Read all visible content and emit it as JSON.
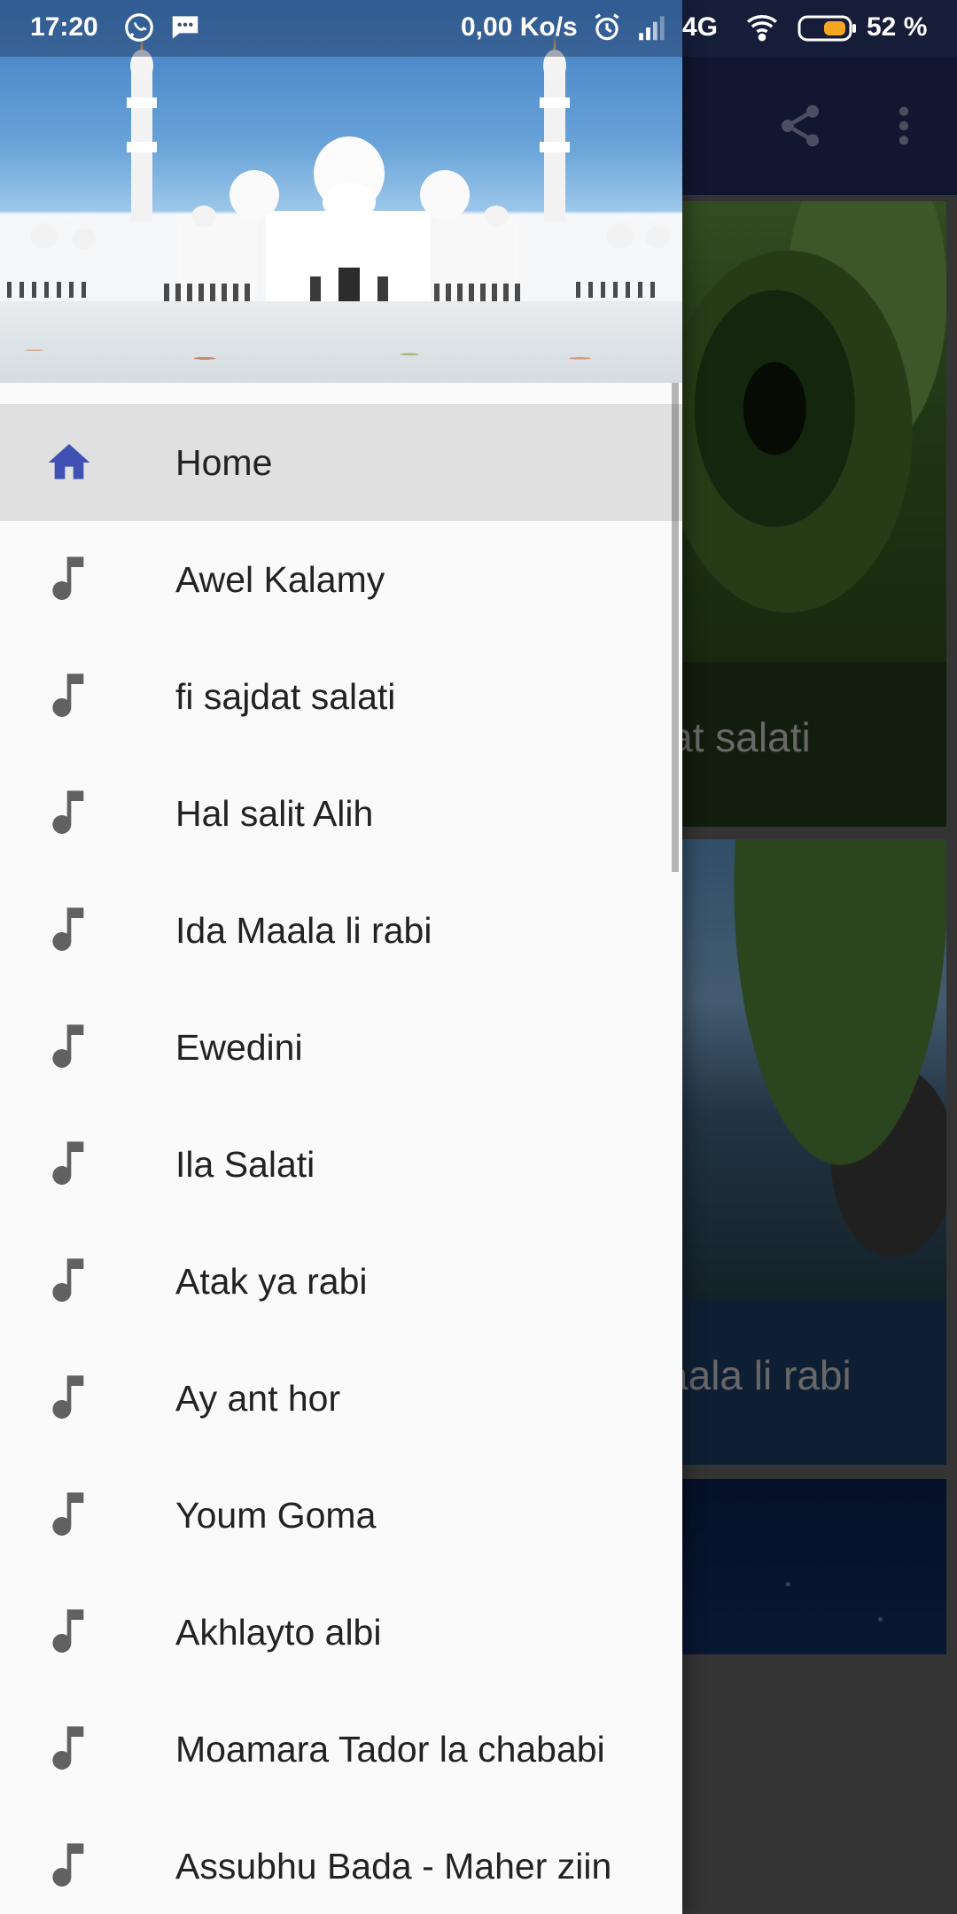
{
  "status_bar": {
    "time": "17:20",
    "network_speed": "0,00 Ko/s",
    "network_type": "4G",
    "battery_percent": "52 %",
    "icons": [
      "whatsapp-icon",
      "message-icon",
      "alarm-icon",
      "signal-icon",
      "wifi-icon",
      "battery-icon"
    ]
  },
  "background_app": {
    "toolbar": {
      "icons": [
        "share-icon",
        "overflow-menu-icon"
      ]
    },
    "cards": [
      {
        "title": "fi sajdat salati"
      },
      {
        "title": "Ida Maala li rabi"
      },
      {
        "title": ""
      }
    ]
  },
  "drawer": {
    "items": [
      {
        "label": "Home",
        "icon": "home-icon",
        "selected": true
      },
      {
        "label": "Awel Kalamy",
        "icon": "music-note-icon"
      },
      {
        "label": "fi sajdat salati",
        "icon": "music-note-icon"
      },
      {
        "label": "Hal salit Alih",
        "icon": "music-note-icon"
      },
      {
        "label": "Ida Maala li rabi",
        "icon": "music-note-icon"
      },
      {
        "label": "Ewedini",
        "icon": "music-note-icon"
      },
      {
        "label": "Ila Salati",
        "icon": "music-note-icon"
      },
      {
        "label": "Atak ya rabi",
        "icon": "music-note-icon"
      },
      {
        "label": "Ay ant hor",
        "icon": "music-note-icon"
      },
      {
        "label": "Youm Goma",
        "icon": "music-note-icon"
      },
      {
        "label": "Akhlayto albi",
        "icon": "music-note-icon"
      },
      {
        "label": "Moamara Tador la chababi",
        "icon": "music-note-icon"
      },
      {
        "label": "Assubhu Bada - Maher ziin",
        "icon": "music-note-icon"
      }
    ]
  },
  "colors": {
    "toolbar": "#1f2a5a",
    "drawer_background": "#fafafa",
    "selected_item_background": "#e0e0e0",
    "home_icon": "#3f51b5",
    "music_icon": "#616161"
  }
}
